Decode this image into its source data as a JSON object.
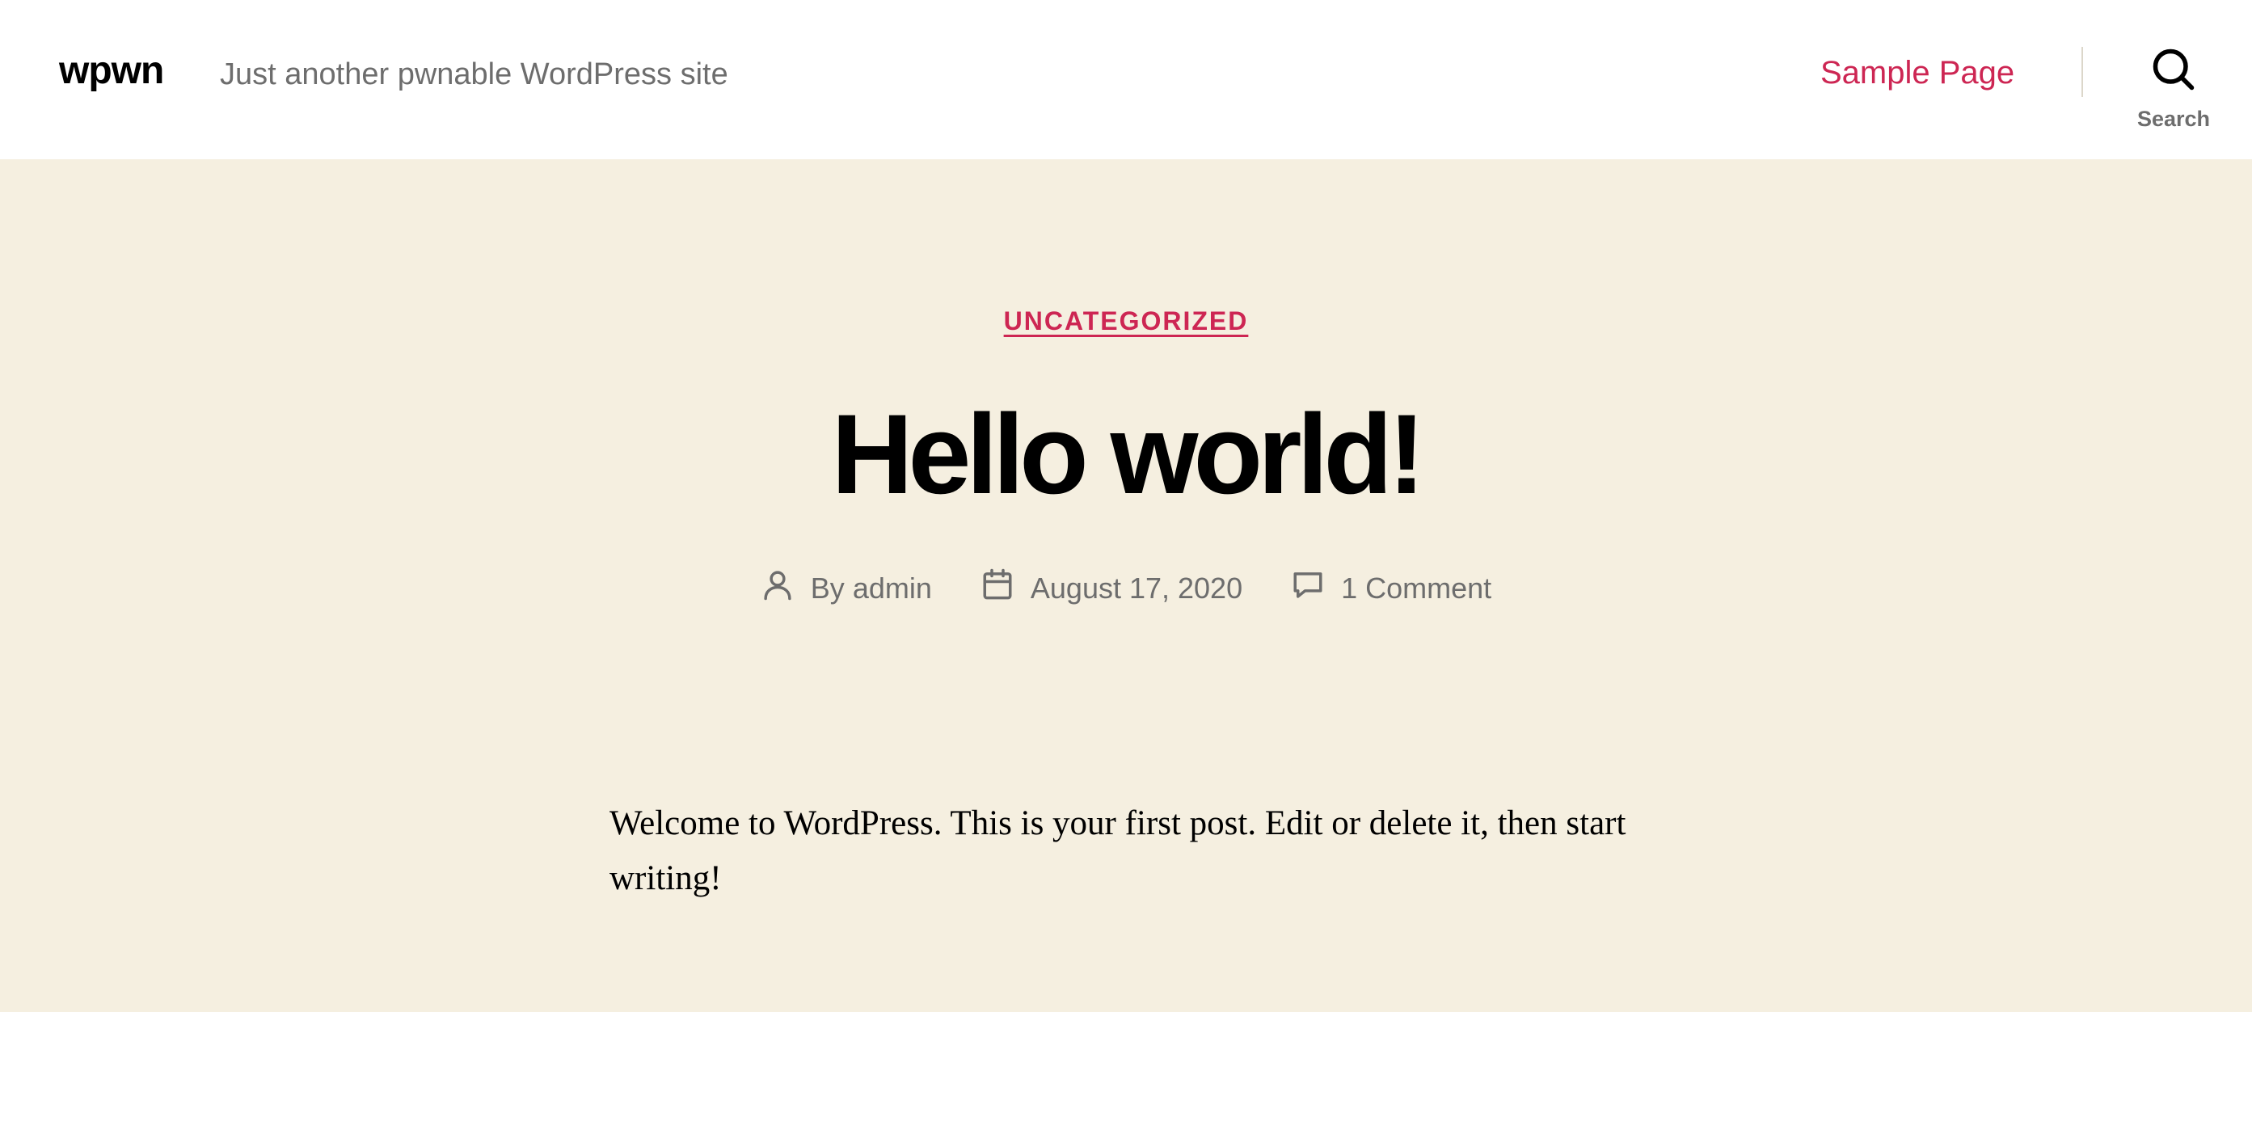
{
  "header": {
    "site_title": "wpwn",
    "site_description": "Just another pwnable WordPress site",
    "nav": {
      "sample_page": "Sample Page"
    },
    "search": {
      "label": "Search",
      "icon": "search-icon"
    }
  },
  "post": {
    "category": "UNCATEGORIZED",
    "title": "Hello world!",
    "meta": {
      "author_prefix": "By",
      "author": "admin",
      "date": "August 17, 2020",
      "comments": "1 Comment"
    },
    "content": "Welcome to WordPress. This is your first post. Edit or delete it, then start writing!"
  },
  "colors": {
    "accent": "#cd2653",
    "hero_background": "#f5efe0",
    "text_secondary": "#6d6d6d"
  }
}
